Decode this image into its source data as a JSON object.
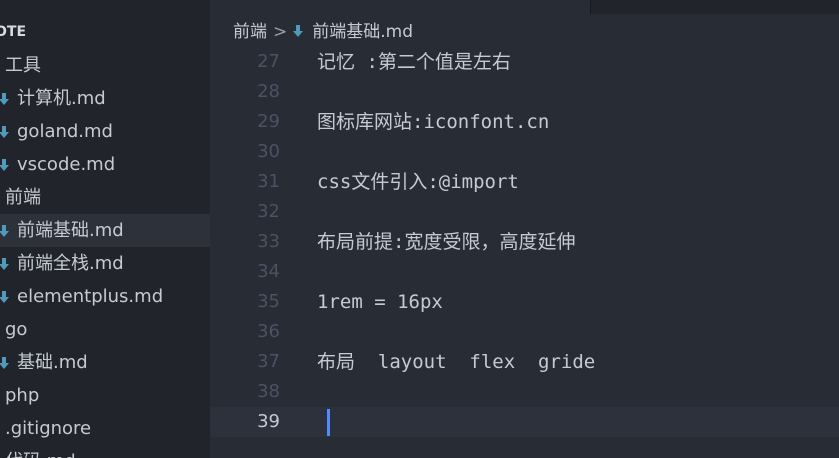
{
  "sidebar": {
    "title": "OTE",
    "items": [
      {
        "label": "工具",
        "kind": "folder"
      },
      {
        "label": "计算机.md",
        "kind": "file"
      },
      {
        "label": "goland.md",
        "kind": "file"
      },
      {
        "label": "vscode.md",
        "kind": "file"
      },
      {
        "label": "前端",
        "kind": "folder"
      },
      {
        "label": "前端基础.md",
        "kind": "file",
        "selected": true
      },
      {
        "label": "前端全栈.md",
        "kind": "file"
      },
      {
        "label": "elementplus.md",
        "kind": "file"
      },
      {
        "label": "go",
        "kind": "folder"
      },
      {
        "label": "基础.md",
        "kind": "file"
      },
      {
        "label": "php",
        "kind": "folder"
      },
      {
        "label": ".gitignore",
        "kind": "folder"
      },
      {
        "label": "代码.md",
        "kind": "folder"
      }
    ]
  },
  "breadcrumb": {
    "folder": "前端",
    "separator": ">",
    "file": "前端基础.md"
  },
  "editor": {
    "line_numbers": [
      "27",
      "28",
      "29",
      "30",
      "31",
      "32",
      "33",
      "34",
      "35",
      "36",
      "37",
      "38",
      "39"
    ],
    "current_line": "39",
    "lines": [
      "记忆 :第二个值是左右",
      "",
      "图标库网站:iconfont.cn",
      "",
      "css文件引入:@import",
      "",
      "布局前提:宽度受限，高度延伸",
      "",
      "1rem = 16px",
      "",
      "布局  layout  flex  gride",
      "",
      ""
    ]
  },
  "colors": {
    "sidebar_bg": "#21252b",
    "editor_bg": "#282c34",
    "md_icon": "#519aba",
    "cursor": "#528bff"
  }
}
